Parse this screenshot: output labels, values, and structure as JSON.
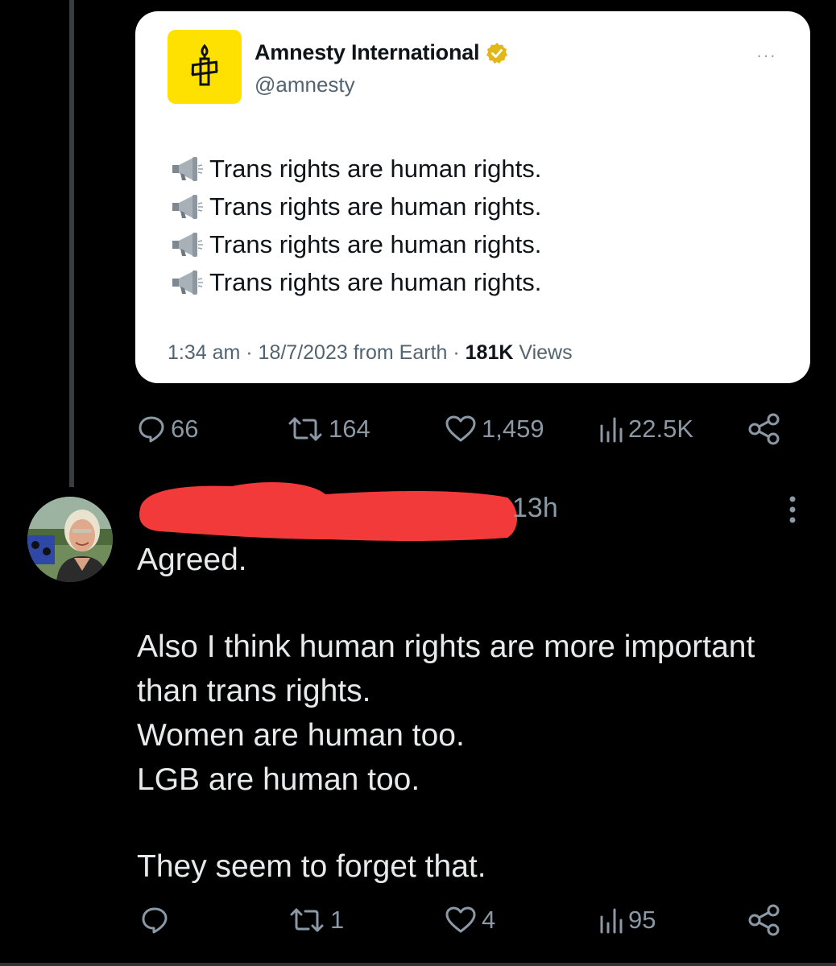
{
  "quoted_tweet": {
    "display_name": "Amnesty International",
    "handle": "@amnesty",
    "more_label": "···",
    "lines": [
      "Trans rights are human rights.",
      "Trans rights are human rights.",
      "Trans rights are human rights.",
      "Trans rights are human rights."
    ],
    "meta_prefix": "1:34 am · 18/7/2023 from Earth · ",
    "views_count": "181K",
    "views_label": " Views"
  },
  "parent_stats": {
    "replies": "66",
    "reposts": "164",
    "likes": "1,459",
    "views": "22.5K"
  },
  "reply": {
    "time": "13h",
    "lines": [
      "Agreed.",
      "",
      "Also I think human rights are more important",
      "than trans rights.",
      "Women are human too.",
      "LGB are human too.",
      "",
      "They seem to forget that."
    ],
    "stats": {
      "replies": "",
      "reposts": "1",
      "likes": "4",
      "views": "95"
    }
  },
  "colors": {
    "background": "#000000",
    "card": "#ffffff",
    "brand_yellow": "#ffe100",
    "verified_gold": "#e2b719",
    "redaction": "#f23a3a",
    "muted": "#8b98a5"
  },
  "icons": [
    "amnesty-candle-logo",
    "verified-badge-icon",
    "megaphone-icon",
    "reply-icon",
    "repost-icon",
    "like-icon",
    "views-icon",
    "share-icon",
    "more-vertical-icon"
  ]
}
